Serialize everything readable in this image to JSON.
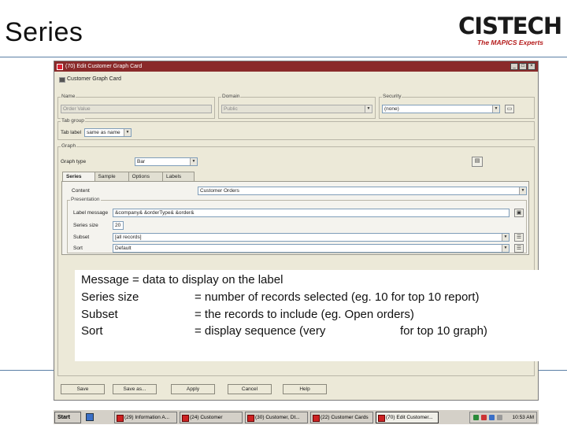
{
  "slide": {
    "title": "Series",
    "logo_main": "CISTECH",
    "logo_tagline": "The MAPICS Experts"
  },
  "window": {
    "title": "(70) Edit Customer Graph Card",
    "toolbar_label": "Customer Graph Card",
    "name_group": {
      "label": "Name",
      "value": "Order Value"
    },
    "domain_group": {
      "label": "Domain",
      "value": "Public"
    },
    "security_group": {
      "label": "Security",
      "value": "(none)"
    },
    "tab_group": {
      "label": "Tab group",
      "field_label": "Tab label",
      "value": "same as name"
    },
    "graph_group": {
      "label": "Graph",
      "type_label": "Graph type",
      "type_value": "Bar"
    },
    "tabs": [
      {
        "label": "Series"
      },
      {
        "label": "Sample"
      },
      {
        "label": "Options"
      },
      {
        "label": "Labels"
      }
    ],
    "series_tab": {
      "content_label": "Content",
      "content_value": "Customer Orders",
      "presentation_label": "Presentation",
      "label_message_label": "Label message",
      "label_message_value": "&company& &orderType& &order&",
      "series_size_label": "Series size",
      "series_size_value": "20",
      "subset_label": "Subset",
      "subset_value": "[all records]",
      "sort_label": "Sort",
      "sort_value": "Default"
    },
    "buttons": [
      {
        "label": "Save"
      },
      {
        "label": "Save as..."
      },
      {
        "label": "Apply"
      },
      {
        "label": "Cancel"
      },
      {
        "label": "Help"
      }
    ]
  },
  "overlay": {
    "rows": [
      {
        "term": "Message  = data to display on the label",
        "desc": ""
      },
      {
        "term": "Series size",
        "desc": "= number of records selected (eg. 10 for top 10 report)"
      },
      {
        "term": "Subset",
        "desc": "= the records to include (eg. Open orders)"
      },
      {
        "term": "Sort",
        "desc": "= display sequence (very",
        "desc_tail": "for top 10 graph)"
      }
    ]
  },
  "taskbar": {
    "start_label": "Start",
    "tasks": [
      {
        "label": "(29) Information A..."
      },
      {
        "label": "(24) Customer"
      },
      {
        "label": "(30) Customer, Dt..."
      },
      {
        "label": "(22) Customer Cards"
      },
      {
        "label": "(70) Edit Customer..."
      }
    ],
    "clock": "10:53 AM"
  }
}
